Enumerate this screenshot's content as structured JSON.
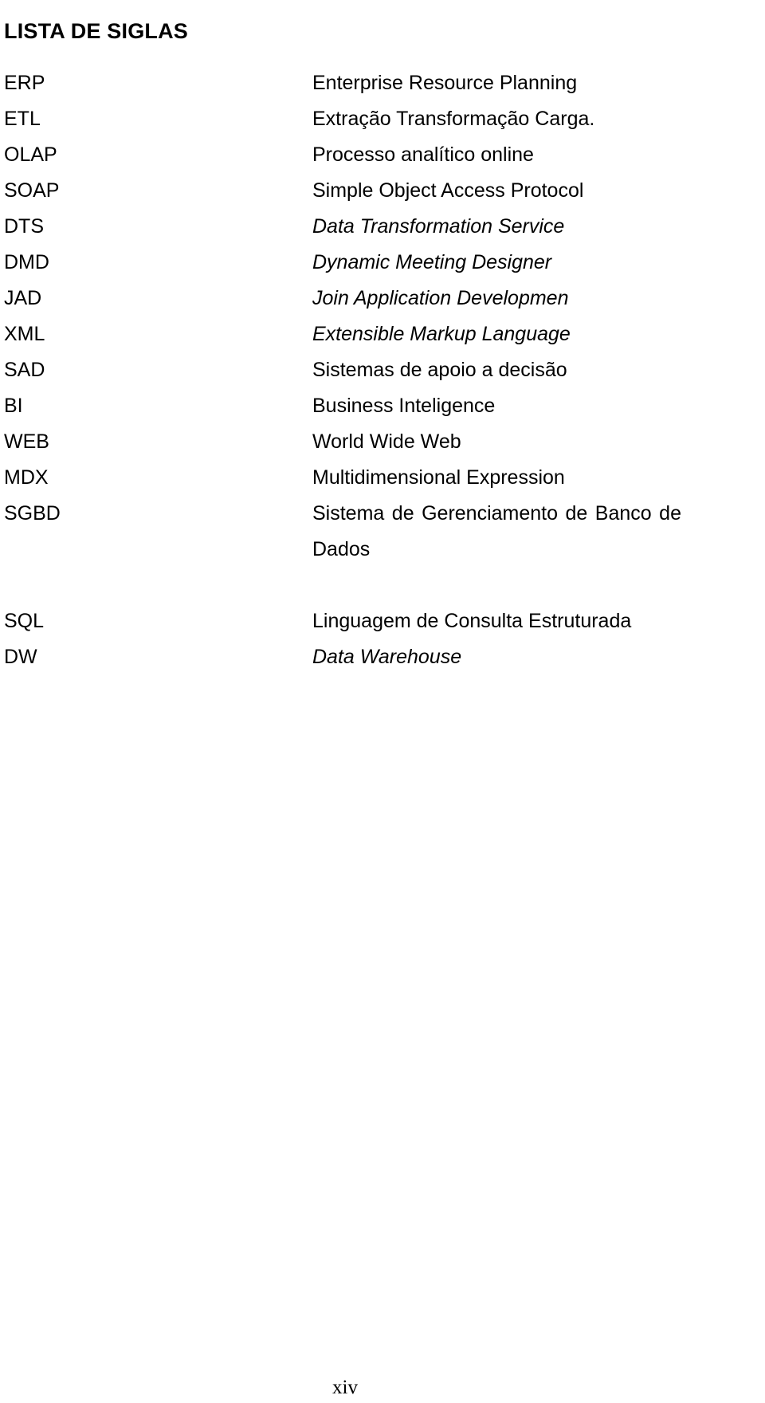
{
  "document": {
    "title": "LISTA DE SIGLAS",
    "page_number": "xiv",
    "language": "pt-BR"
  },
  "acronyms": [
    {
      "term": "ERP",
      "definition": "Enterprise Resource Planning",
      "style": "roman",
      "wraps": false
    },
    {
      "term": "ETL",
      "definition": "Extração Transformação Carga.",
      "style": "roman",
      "wraps": false
    },
    {
      "term": "OLAP",
      "definition": "Processo analítico online",
      "style": "roman",
      "wraps": false
    },
    {
      "term": "SOAP",
      "definition": "Simple Object Access Protocol",
      "style": "roman",
      "wraps": false
    },
    {
      "term": "DTS",
      "definition": "Data Transformation Service",
      "style": "italic",
      "wraps": false
    },
    {
      "term": "DMD",
      "definition": "Dynamic Meeting Designer",
      "style": "italic",
      "wraps": false
    },
    {
      "term": "JAD",
      "definition": "Join Application Developmen",
      "style": "italic",
      "wraps": false
    },
    {
      "term": "XML",
      "definition": "Extensible Markup Language",
      "style": "italic",
      "wraps": false
    },
    {
      "term": "SAD",
      "definition": "Sistemas de apoio a decisão",
      "style": "roman",
      "wraps": false
    },
    {
      "term": "BI",
      "definition": "Business Inteligence",
      "style": "roman",
      "wraps": false
    },
    {
      "term": "WEB",
      "definition": "World Wide Web",
      "style": "roman",
      "wraps": false
    },
    {
      "term": "MDX",
      "definition": "Multidimensional Expression",
      "style": "roman",
      "wraps": false
    },
    {
      "term": "SGBD",
      "definition": "Sistema de Gerenciamento de Banco de Dados",
      "style": "roman",
      "wraps": true
    },
    {
      "term": "SQL",
      "definition": "Linguagem de Consulta Estruturada",
      "style": "roman",
      "wraps": false
    },
    {
      "term": "DW",
      "definition": "Data Warehouse",
      "style": "italic",
      "wraps": false
    }
  ]
}
